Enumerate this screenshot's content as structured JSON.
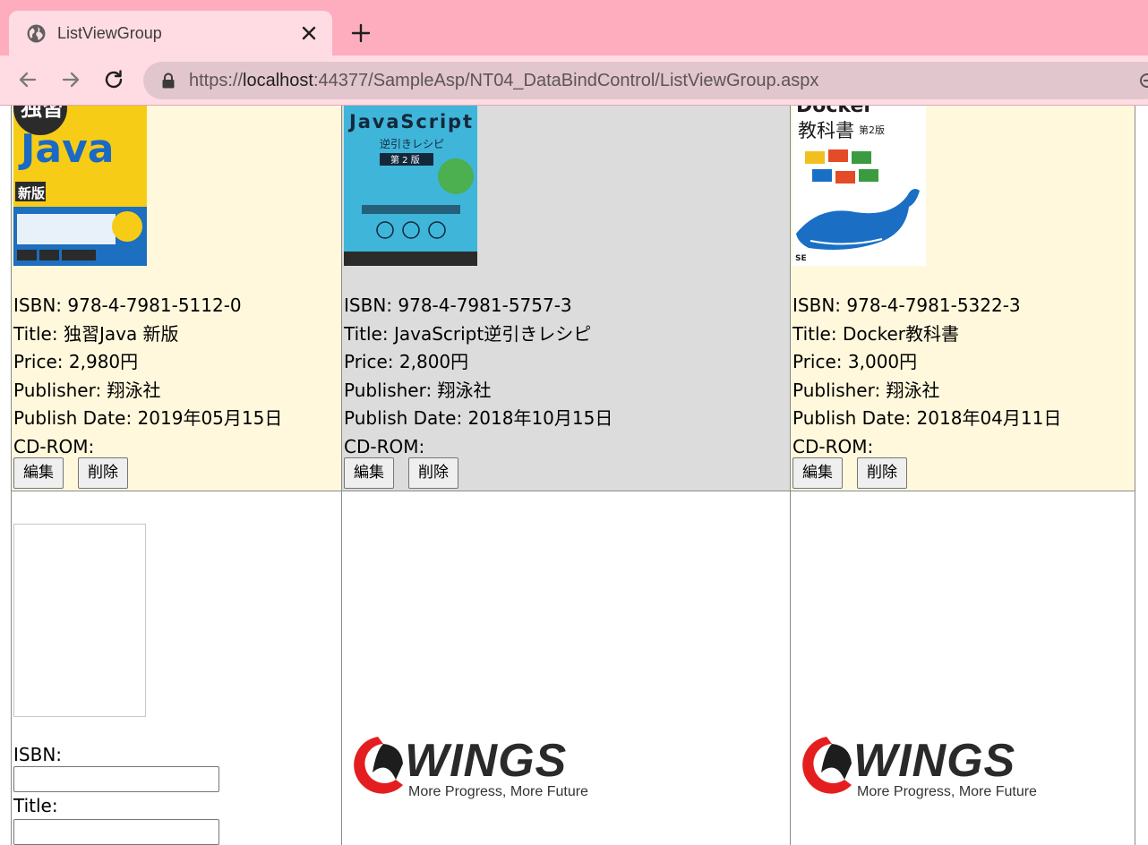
{
  "browser": {
    "tab_title": "ListViewGroup",
    "url_prefix": "https://",
    "url_host": "localhost",
    "url_rest": ":44377/SampleAsp/NT04_DataBindControl/ListViewGroup.aspx",
    "accent_color": "#fdadbd",
    "icons": [
      "globe-icon",
      "close-icon",
      "plus-icon",
      "back-icon",
      "forward-icon",
      "reload-icon",
      "lock-icon"
    ]
  },
  "books": [
    {
      "cover_text": [
        "独習",
        "Java",
        "新版"
      ],
      "isbn": "ISBN: 978-4-7981-5112-0",
      "title": "Title: 独習Java 新版",
      "price": "Price: 2,980円",
      "publisher": "Publisher: 翔泳社",
      "publish_date": "Publish Date: 2019年05月15日",
      "cdrom": "CD-ROM:",
      "edit_label": "編集",
      "delete_label": "削除"
    },
    {
      "cover_text": [
        "JavaScript",
        "逆引きレシピ",
        "第 2 版"
      ],
      "isbn": "ISBN: 978-4-7981-5757-3",
      "title": "Title: JavaScript逆引きレシピ",
      "price": "Price: 2,800円",
      "publisher": "Publisher: 翔泳社",
      "publish_date": "Publish Date: 2018年10月15日",
      "cdrom": "CD-ROM:",
      "edit_label": "編集",
      "delete_label": "削除"
    },
    {
      "cover_text": [
        "Docker",
        "教科書",
        "第2版"
      ],
      "isbn": "ISBN: 978-4-7981-5322-3",
      "title": "Title: Docker教科書",
      "price": "Price: 3,000円",
      "publisher": "Publisher: 翔泳社",
      "publish_date": "Publish Date: 2018年04月11日",
      "cdrom": "CD-ROM:",
      "edit_label": "編集",
      "delete_label": "削除"
    }
  ],
  "insert_form": {
    "isbn_label": "ISBN:",
    "isbn_value": "",
    "title_label": "Title:",
    "title_value": ""
  },
  "placeholder_logo": {
    "name": "WINGS",
    "tagline": "More Progress, More Future"
  }
}
